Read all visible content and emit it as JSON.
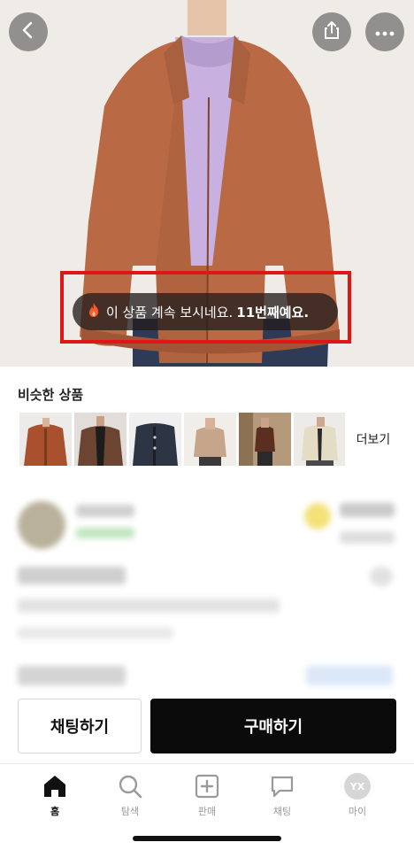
{
  "hero": {
    "toast": {
      "text": "이 상품 계속 보시네요.",
      "count": "11번째예요.",
      "icon": "fire-icon"
    },
    "icons": {
      "back": "chevron-left-icon",
      "share": "share-icon",
      "more": "more-dots-icon"
    }
  },
  "similar": {
    "title": "비슷한 상품",
    "more_label": "더보기",
    "thumbs": [
      {
        "name": "rust-jacket"
      },
      {
        "name": "brown-jacket"
      },
      {
        "name": "navy-jacket"
      },
      {
        "name": "beige-jacket"
      },
      {
        "name": "brown-outfit"
      },
      {
        "name": "cream-jacket"
      }
    ]
  },
  "actions": {
    "chat_label": "채팅하기",
    "buy_label": "구매하기"
  },
  "tabbar": {
    "items": [
      {
        "label": "홈",
        "icon": "home-icon"
      },
      {
        "label": "탐색",
        "icon": "search-icon"
      },
      {
        "label": "판매",
        "icon": "plus-square-icon"
      },
      {
        "label": "채팅",
        "icon": "chat-bubble-icon"
      },
      {
        "label": "마이",
        "icon": "avatar-icon",
        "initials": "YX"
      }
    ]
  },
  "colors": {
    "accent": "#e01616",
    "buy_bg": "#0b0b0b",
    "jacket": "#b96a45"
  }
}
